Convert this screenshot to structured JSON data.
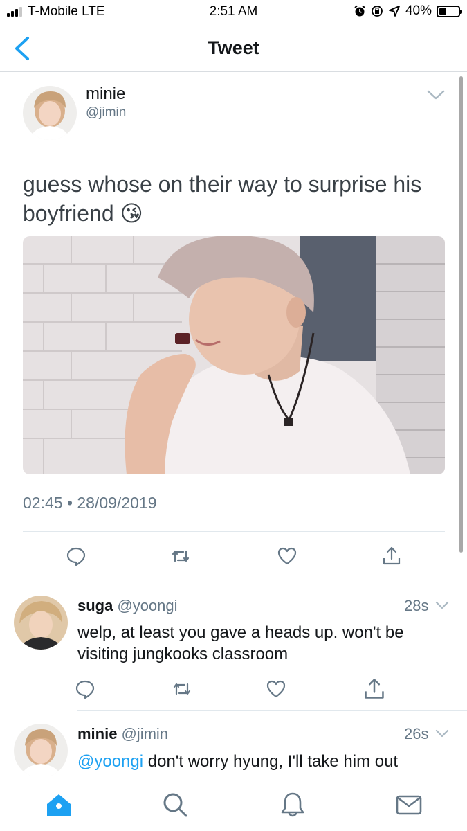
{
  "status_bar": {
    "carrier": "T-Mobile LTE",
    "time": "2:51 AM",
    "battery": "40%",
    "battery_level": 0.4
  },
  "nav": {
    "title": "Tweet",
    "back_icon": "chevron-left-icon"
  },
  "main_tweet": {
    "display_name": "minie",
    "handle": "@jimin",
    "text": "guess whose on their way to surprise his boyfriend",
    "emoji": "😘",
    "timestamp": "02:45 • 28/09/2019",
    "actions": [
      "reply-icon",
      "retweet-icon",
      "like-icon",
      "share-icon"
    ]
  },
  "replies": [
    {
      "display_name": "suga",
      "handle": "@yoongi",
      "time": "28s",
      "text": "welp, at least you gave a heads up. won't be visiting jungkooks classroom"
    },
    {
      "display_name": "minie",
      "handle": "@jimin",
      "time": "26s",
      "mention": "@yoongi",
      "text": " don't worry hyung, I'll take him out"
    }
  ],
  "tab_bar": {
    "items": [
      "home-icon",
      "search-icon",
      "notifications-icon",
      "messages-icon"
    ]
  },
  "colors": {
    "accent": "#1da1f2",
    "secondary_text": "#657786",
    "divider": "#e1e8ed"
  }
}
